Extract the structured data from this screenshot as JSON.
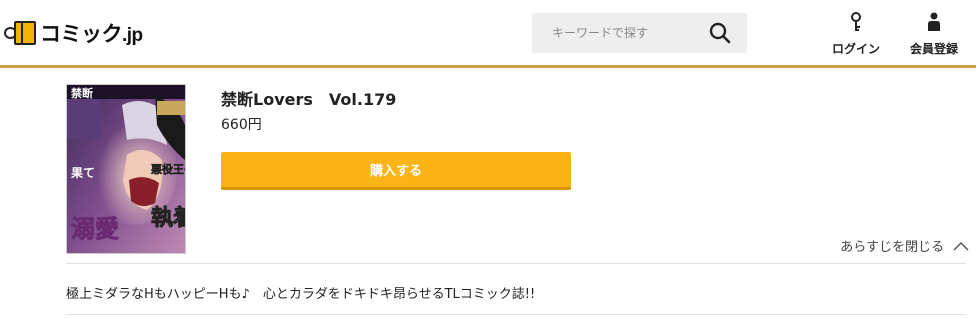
{
  "header": {
    "logo_text_main": "コミック",
    "logo_text_suffix": ".jp",
    "search_placeholder": "キーワードで探す",
    "login_label": "ログイン",
    "register_label": "会員登録",
    "accent_color": "#c9a24a"
  },
  "product": {
    "title": "禁断Lovers　Vol.179",
    "price": "660円",
    "buy_label": "購入する",
    "buy_color": "#fbb416",
    "cover": {
      "magazine_title": "禁断",
      "title_left": "溺愛",
      "title_right": "執着",
      "title_right_top": "悪役王子",
      "subtitle_left": "果て"
    }
  },
  "synopsis": {
    "toggle_label": "あらすじを閉じる",
    "text": "極上ミダラなHもハッピーHも♪　心とカラダをドキドキ昂らせるTLコミック誌!!"
  },
  "icons": {
    "search": "search-icon",
    "login": "key-icon",
    "register": "person-icon",
    "toggle": "chevron-up-icon"
  }
}
